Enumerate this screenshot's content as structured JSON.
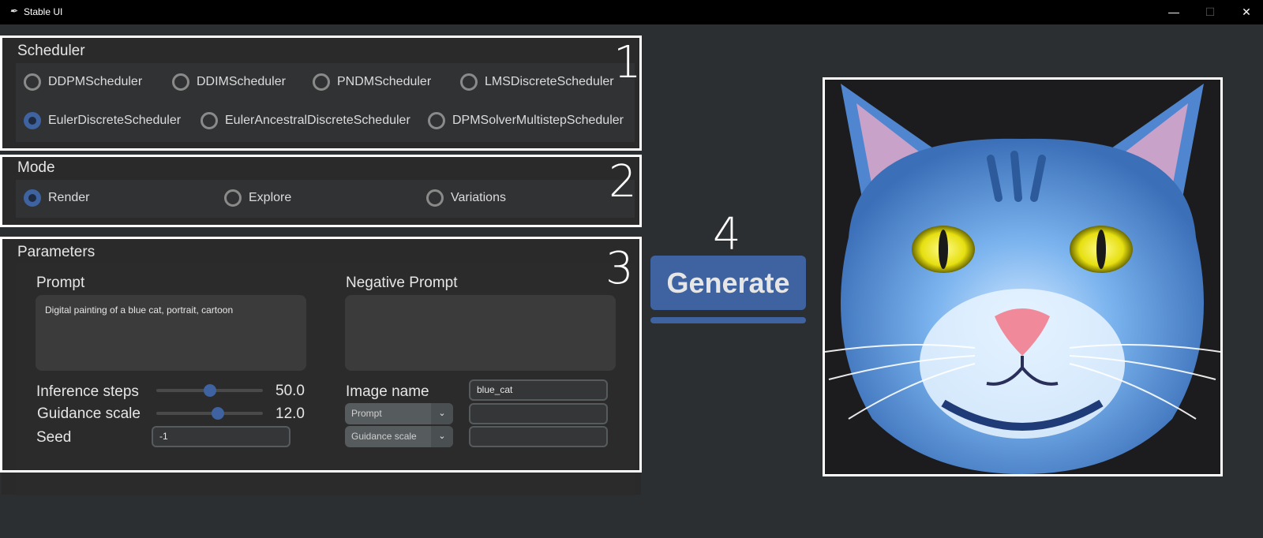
{
  "window": {
    "title": "Stable UI",
    "min": "—",
    "max": "☐",
    "close": "✕"
  },
  "scheduler": {
    "label": "Scheduler",
    "number": "1",
    "options": [
      "DDPMScheduler",
      "DDIMScheduler",
      "PNDMScheduler",
      "LMSDiscreteScheduler",
      "EulerDiscreteScheduler",
      "EulerAncestralDiscreteScheduler",
      "DPMSolverMultistepScheduler"
    ],
    "selected": "EulerDiscreteScheduler"
  },
  "mode": {
    "label": "Mode",
    "number": "2",
    "options": [
      "Render",
      "Explore",
      "Variations"
    ],
    "selected": "Render"
  },
  "parameters": {
    "label": "Parameters",
    "number": "3",
    "prompt_label": "Prompt",
    "prompt_value": "Digital painting of a blue cat, portrait, cartoon",
    "negative_prompt_label": "Negative Prompt",
    "negative_prompt_value": "",
    "inference_steps_label": "Inference steps",
    "inference_steps_value": "50.0",
    "inference_steps_fraction": 0.5,
    "guidance_scale_label": "Guidance scale",
    "guidance_scale_value": "12.0",
    "guidance_scale_fraction": 0.58,
    "seed_label": "Seed",
    "seed_value": "-1",
    "image_name_label": "Image name",
    "image_name_value": "blue_cat",
    "combo1": "Prompt",
    "combo2": "Guidance scale",
    "combo1_value": "",
    "combo2_value": ""
  },
  "generate": {
    "number": "4",
    "label": "Generate",
    "progress": 1.0
  },
  "preview": {
    "subject": "blue cat portrait"
  },
  "colors": {
    "accent": "#3e63a0",
    "background": "#2b2f32",
    "outline": "#ffffff"
  }
}
